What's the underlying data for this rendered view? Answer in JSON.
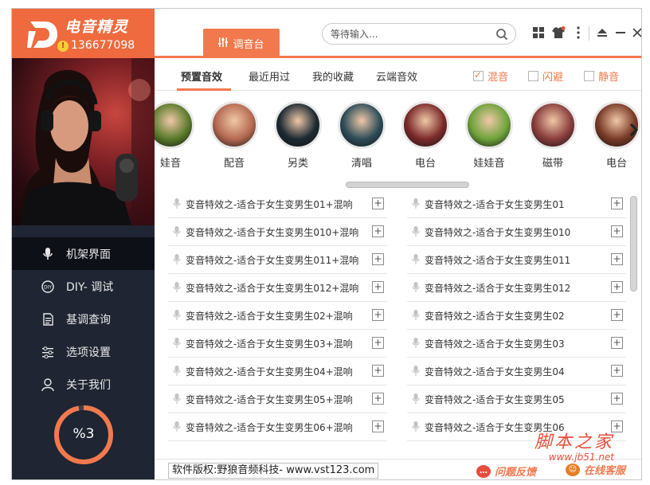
{
  "app": {
    "name": "电音精灵",
    "user_id": "136677098"
  },
  "colors": {
    "accent": "#f2794e",
    "brand": "#ef6a3e",
    "sidebar": "#1f2532",
    "sidebar_active": "#0d1017"
  },
  "header": {
    "mixer_tab": "调音台",
    "search": {
      "placeholder": "等待输入...",
      "value": ""
    },
    "icons": [
      "apps-icon",
      "skin-icon",
      "menu-icon",
      "minimize-icon",
      "close-icon"
    ]
  },
  "sidebar": {
    "items": [
      {
        "label": "机架界面",
        "icon": "mic-icon",
        "active": true
      },
      {
        "label": "DIY- 调试",
        "icon": "diy-icon",
        "active": false
      },
      {
        "label": "基调查询",
        "icon": "document-icon",
        "active": false
      },
      {
        "label": "选项设置",
        "icon": "settings-sliders-icon",
        "active": false
      },
      {
        "label": "关于我们",
        "icon": "user-icon",
        "active": false
      }
    ],
    "meter": {
      "label": "%3",
      "value": 0.97
    }
  },
  "subtabs": {
    "items": [
      "预置音效",
      "最近用过",
      "我的收藏",
      "云端音效"
    ],
    "active": 0,
    "options": [
      {
        "label": "混音",
        "checked": true
      },
      {
        "label": "闪避",
        "checked": false
      },
      {
        "label": "静音",
        "checked": false
      }
    ]
  },
  "categories": [
    {
      "label": "娃音",
      "color": "#5a7a2b"
    },
    {
      "label": "配音",
      "color": "#b56a52"
    },
    {
      "label": "另类",
      "color": "#1d2a33"
    },
    {
      "label": "清唱",
      "color": "#2e4d59"
    },
    {
      "label": "电台",
      "color": "#7b2a2a"
    },
    {
      "label": "娃娃音",
      "color": "#6fa33b"
    },
    {
      "label": "磁带",
      "color": "#8a3d3d"
    },
    {
      "label": "电台",
      "color": "#7a3a28"
    }
  ],
  "effects": {
    "left": [
      "变音特效之-适合于女生变男生01+混响",
      "变音特效之-适合于女生变男生010+混响",
      "变音特效之-适合于女生变男生011+混响",
      "变音特效之-适合于女生变男生012+混响",
      "变音特效之-适合于女生变男生02+混响",
      "变音特效之-适合于女生变男生03+混响",
      "变音特效之-适合于女生变男生04+混响",
      "变音特效之-适合于女生变男生05+混响",
      "变音特效之-适合于女生变男生06+混响"
    ],
    "right": [
      "变音特效之-适合于女生变男生01",
      "变音特效之-适合于女生变男生010",
      "变音特效之-适合于女生变男生011",
      "变音特效之-适合于女生变男生012",
      "变音特效之-适合于女生变男生02",
      "变音特效之-适合于女生变男生03",
      "变音特效之-适合于女生变男生04",
      "变音特效之-适合于女生变男生05",
      "变音特效之-适合于女生变男生06"
    ],
    "add_label": "+"
  },
  "footer": {
    "copyright": "软件版权:野狼音频科技- www.vst123.com",
    "feedback": "问题反馈",
    "support": "在线客服"
  },
  "watermark": {
    "title": "脚本之家",
    "url": "www.jb51.net"
  }
}
